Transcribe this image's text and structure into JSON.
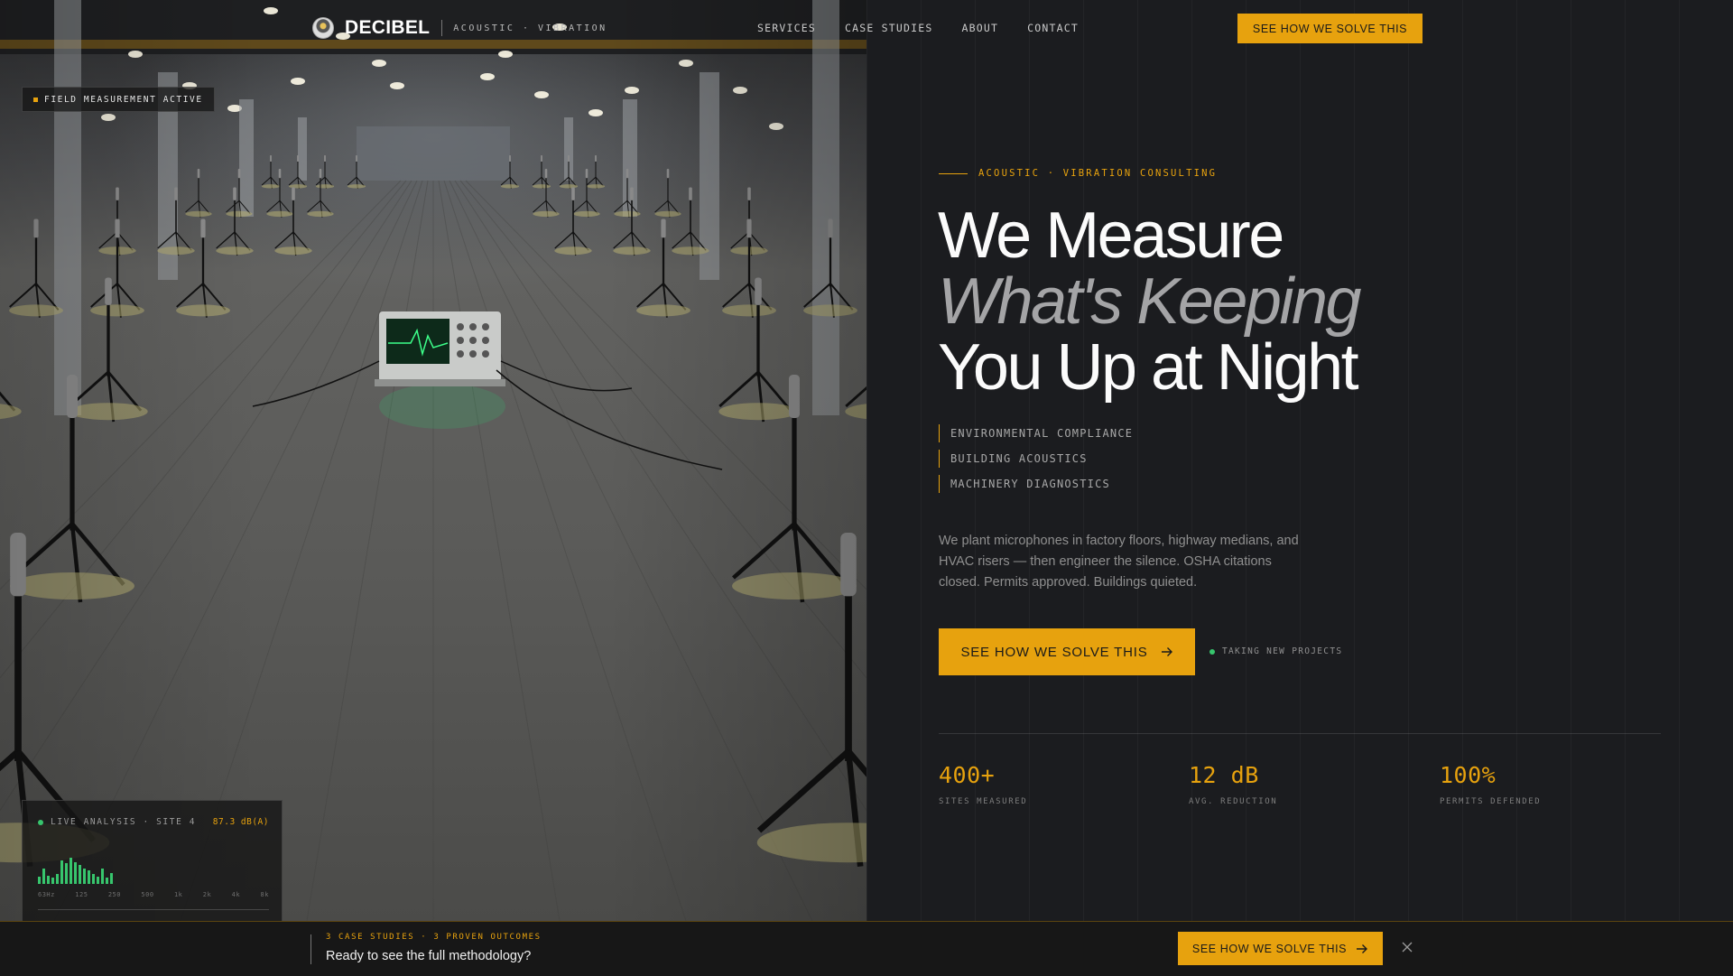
{
  "brand": {
    "name": "DECIBEL",
    "tagline": "ACOUSTIC · VIBRATION",
    "logo_icon": "decibel-logo-icon"
  },
  "nav": {
    "links": [
      "SERVICES",
      "CASE STUDIES",
      "ABOUT",
      "CONTACT"
    ],
    "cta": "SEE HOW WE SOLVE THIS"
  },
  "photo": {
    "badge": "FIELD MEASUREMENT ACTIVE",
    "analysis": {
      "title": "LIVE ANALYSIS · SITE 4",
      "reading": "87.3 dB(A)",
      "frequencies": [
        "63Hz",
        "125",
        "250",
        "500",
        "1k",
        "2k",
        "4k",
        "8k"
      ],
      "levels": [
        0.25,
        0.55,
        0.3,
        0.22,
        0.35,
        0.85,
        0.75,
        0.95,
        0.8,
        0.7,
        0.55,
        0.5,
        0.38,
        0.28,
        0.55,
        0.22,
        0.4
      ]
    }
  },
  "hero": {
    "eyebrow": "ACOUSTIC · VIBRATION CONSULTING",
    "headline_1": "We Measure",
    "headline_2": "What's Keeping",
    "headline_3": "You Up at Night",
    "tags": [
      "ENVIRONMENTAL COMPLIANCE",
      "BUILDING ACOUSTICS",
      "MACHINERY DIAGNOSTICS"
    ],
    "description": "We plant microphones in factory floors, highway medians, and HVAC risers — then engineer the silence. OSHA citations closed. Permits approved. Buildings quieted.",
    "cta": "SEE HOW WE SOLVE THIS",
    "availability": "TAKING NEW PROJECTS",
    "stats": [
      {
        "value": "400+",
        "label": "SITES MEASURED"
      },
      {
        "value": "12 dB",
        "label": "AVG. REDUCTION"
      },
      {
        "value": "100%",
        "label": "PERMITS DEFENDED"
      }
    ]
  },
  "bottom_bar": {
    "kicker": "3 CASE STUDIES · 3 PROVEN OUTCOMES",
    "text": "Ready to see the full methodology?",
    "cta": "SEE HOW WE SOLVE THIS",
    "close_icon": "close-icon"
  },
  "colors": {
    "accent": "#e7a20e",
    "background": "#1b1c1f",
    "live": "#37c56d"
  }
}
